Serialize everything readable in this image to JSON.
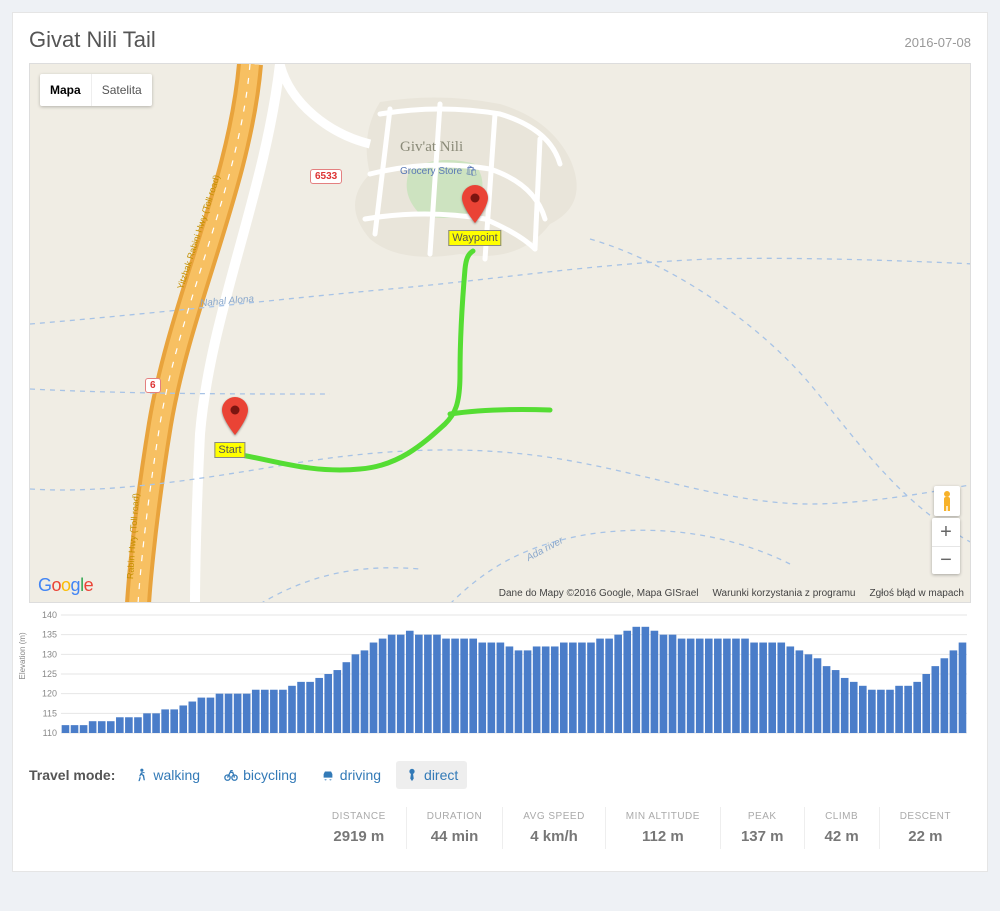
{
  "header": {
    "title": "Givat Nili Tail",
    "date": "2016-07-08"
  },
  "map": {
    "tabs": {
      "map": "Mapa",
      "satellite": "Satelita"
    },
    "active_tab": "map",
    "logo": "Google",
    "place_name": "Giv'at Nili",
    "poi": "Grocery Store",
    "road_badges": {
      "r6": "6",
      "r6533": "6533"
    },
    "road_labels": {
      "rabin1": "Yitzhak Rabini Hwy (Toll road)",
      "rabin2": "Rabin Hwy (Toll road)"
    },
    "rivers": {
      "alona": "Nahal Alona",
      "ada": "Ada river"
    },
    "markers": {
      "start": "Start",
      "waypoint": "Waypoint"
    },
    "footer": {
      "data": "Dane do Mapy ©2016 Google, Mapa GISrael",
      "terms": "Warunki korzystania z programu",
      "report": "Zgłoś błąd w mapach"
    },
    "zoom": {
      "in": "+",
      "out": "−"
    }
  },
  "chart_data": {
    "type": "bar",
    "ylabel": "Elevation (m)",
    "ylim": [
      110,
      140
    ],
    "yticks": [
      110,
      115,
      120,
      125,
      130,
      135,
      140
    ],
    "values": [
      112,
      112,
      112,
      113,
      113,
      113,
      114,
      114,
      114,
      115,
      115,
      116,
      116,
      117,
      118,
      119,
      119,
      120,
      120,
      120,
      120,
      121,
      121,
      121,
      121,
      122,
      123,
      123,
      124,
      125,
      126,
      128,
      130,
      131,
      133,
      134,
      135,
      135,
      136,
      135,
      135,
      135,
      134,
      134,
      134,
      134,
      133,
      133,
      133,
      132,
      131,
      131,
      132,
      132,
      132,
      133,
      133,
      133,
      133,
      134,
      134,
      135,
      136,
      137,
      137,
      136,
      135,
      135,
      134,
      134,
      134,
      134,
      134,
      134,
      134,
      134,
      133,
      133,
      133,
      133,
      132,
      131,
      130,
      129,
      127,
      126,
      124,
      123,
      122,
      121,
      121,
      121,
      122,
      122,
      123,
      125,
      127,
      129,
      131,
      133
    ]
  },
  "travel": {
    "label": "Travel mode:",
    "modes": {
      "walking": "walking",
      "bicycling": "bicycling",
      "driving": "driving",
      "direct": "direct"
    },
    "active": "direct"
  },
  "stats": [
    {
      "label": "DISTANCE",
      "value": "2919 m"
    },
    {
      "label": "DURATION",
      "value": "44 min"
    },
    {
      "label": "AVG SPEED",
      "value": "4 km/h"
    },
    {
      "label": "MIN ALTITUDE",
      "value": "112 m"
    },
    {
      "label": "PEAK",
      "value": "137 m"
    },
    {
      "label": "CLIMB",
      "value": "42 m"
    },
    {
      "label": "DESCENT",
      "value": "22 m"
    }
  ]
}
